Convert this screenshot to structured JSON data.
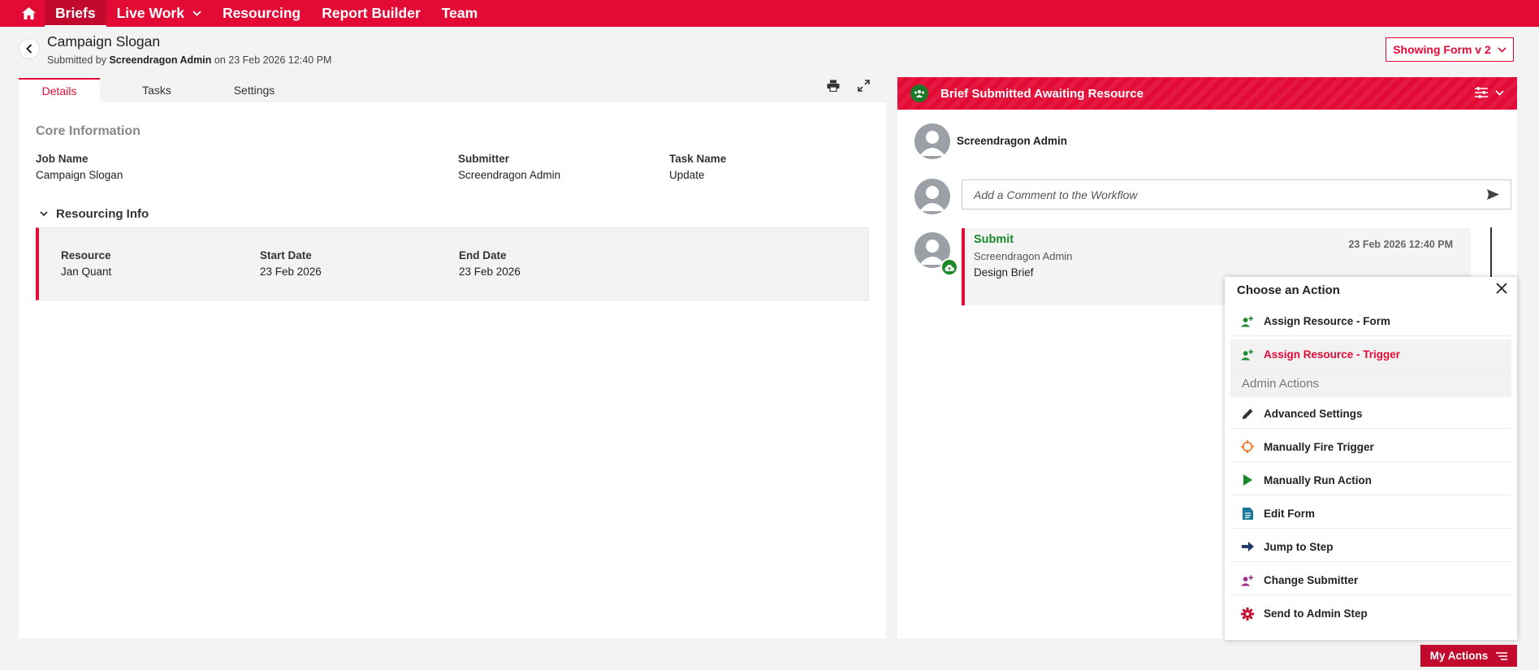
{
  "nav": {
    "items": [
      {
        "label": "Briefs"
      },
      {
        "label": "Live Work"
      },
      {
        "label": "Resourcing"
      },
      {
        "label": "Report Builder"
      },
      {
        "label": "Team"
      }
    ]
  },
  "header": {
    "title": "Campaign Slogan",
    "submitted_prefix": "Submitted by",
    "submitted_by": "Screendragon Admin",
    "submitted_on": "on 23 Feb 2026 12:40 PM",
    "form_button": "Showing Form v 2"
  },
  "tabs": [
    {
      "label": "Details",
      "active": true
    },
    {
      "label": "Tasks",
      "active": false
    },
    {
      "label": "Settings",
      "active": false
    }
  ],
  "core": {
    "title": "Core Information",
    "fields": [
      {
        "label": "Job Name",
        "value": "Campaign Slogan"
      },
      {
        "label": "Submitter",
        "value": "Screendragon Admin"
      },
      {
        "label": "Task Name",
        "value": "Update"
      }
    ]
  },
  "resourcing": {
    "title": "Resourcing Info",
    "fields": [
      {
        "label": "Resource",
        "value": "Jan Quant"
      },
      {
        "label": "Start Date",
        "value": "23 Feb 2026"
      },
      {
        "label": "End Date",
        "value": "23 Feb 2026"
      }
    ]
  },
  "workflow": {
    "status": "Brief Submitted Awaiting Resource",
    "user": "Screendragon Admin",
    "comment_placeholder": "Add a Comment to the Workflow",
    "log": {
      "title": "Submit",
      "user": "Screendragon Admin",
      "description": "Design Brief",
      "time": "23 Feb 2026 12:40 PM"
    }
  },
  "actions_popup": {
    "title": "Choose an Action",
    "items": [
      {
        "label": "Assign Resource - Form",
        "icon": "user-plus-icon"
      },
      {
        "label": "Assign Resource - Trigger",
        "icon": "user-plus-icon"
      }
    ],
    "admin_title": "Admin Actions",
    "admin_items": [
      {
        "label": "Advanced Settings",
        "icon": "pencil-icon"
      },
      {
        "label": "Manually Fire Trigger",
        "icon": "crosshair-icon"
      },
      {
        "label": "Manually Run Action",
        "icon": "play-icon"
      },
      {
        "label": "Edit Form",
        "icon": "form-icon"
      },
      {
        "label": "Jump to Step",
        "icon": "arrow-right-icon"
      },
      {
        "label": "Change Submitter",
        "icon": "user-plus-icon"
      },
      {
        "label": "Send to Admin Step",
        "icon": "gear-icon"
      }
    ]
  },
  "my_actions": "My Actions",
  "colors": {
    "brand": "#e30b36",
    "success": "#1a8a2a"
  }
}
